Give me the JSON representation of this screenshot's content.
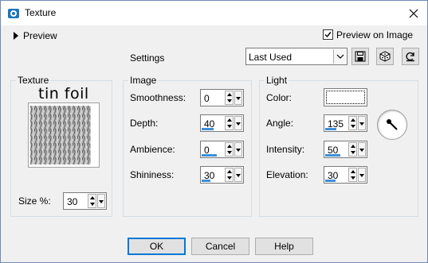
{
  "window": {
    "title": "Texture"
  },
  "preview": {
    "label": "Preview",
    "preview_on_image_label": "Preview on Image",
    "preview_on_image_checked": true
  },
  "settings": {
    "label": "Settings",
    "preset_value": "Last Used"
  },
  "texture": {
    "group_label": "Texture",
    "name": "tin foil",
    "size_label": "Size %:",
    "size_value": "30"
  },
  "image": {
    "group_label": "Image",
    "smoothness_label": "Smoothness:",
    "smoothness_value": "0",
    "smoothness_fraction": 0.0,
    "depth_label": "Depth:",
    "depth_value": "40",
    "depth_fraction": 0.4,
    "ambience_label": "Ambience:",
    "ambience_value": "0",
    "ambience_fraction": 0.5,
    "shininess_label": "Shininess:",
    "shininess_value": "30",
    "shininess_fraction": 0.3
  },
  "light": {
    "group_label": "Light",
    "color_label": "Color:",
    "color_value": "#ffffff",
    "angle_label": "Angle:",
    "angle_value": "135",
    "angle_fraction": 0.375,
    "intensity_label": "Intensity:",
    "intensity_value": "50",
    "intensity_fraction": 0.5,
    "elevation_label": "Elevation:",
    "elevation_value": "30",
    "elevation_fraction": 0.333
  },
  "buttons": {
    "ok": "OK",
    "cancel": "Cancel",
    "help": "Help"
  },
  "colors": {
    "accent": "#0078d7",
    "slider": "#3c8fd8",
    "background": "#f0f0f0"
  }
}
